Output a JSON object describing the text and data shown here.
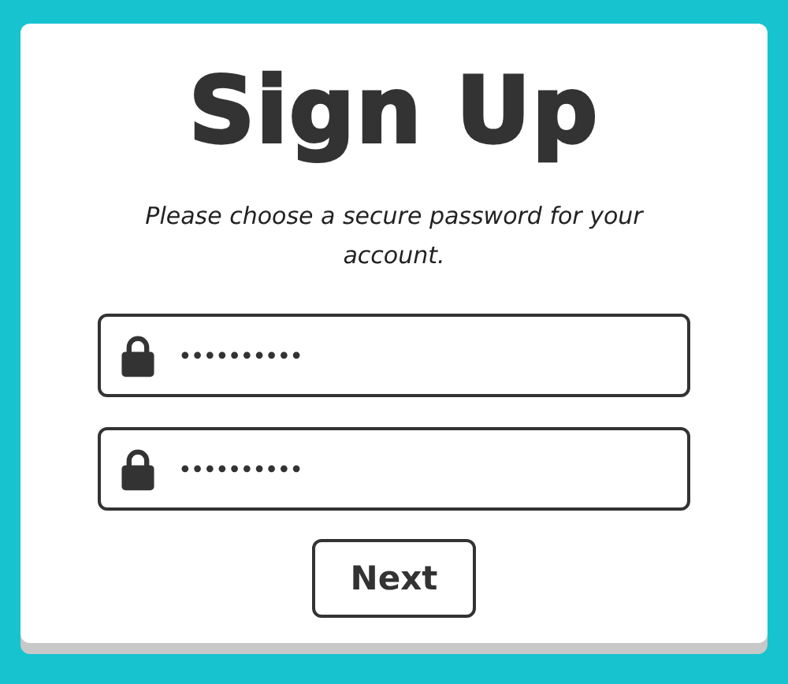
{
  "title": "Sign Up",
  "subtitle": "Please choose a secure password for your account.",
  "fields": [
    {
      "value": "••••••••••"
    },
    {
      "value": "••••••••••"
    }
  ],
  "buttons": [
    "Next"
  ]
}
